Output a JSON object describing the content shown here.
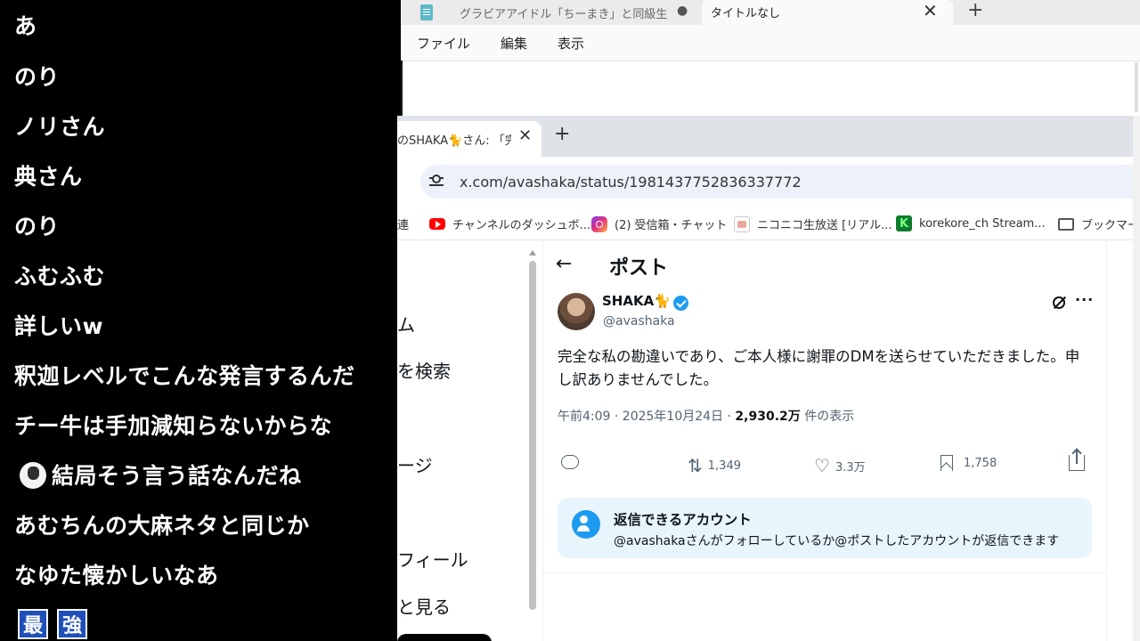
{
  "comments": [
    {
      "text": "あ"
    },
    {
      "text": "のり"
    },
    {
      "text": "ノリさん"
    },
    {
      "text": "典さん"
    },
    {
      "text": "のり"
    },
    {
      "text": "ふむふむ"
    },
    {
      "text": "詳しいw"
    },
    {
      "text": "釈迦レベルでこんな発言するんだ"
    },
    {
      "text": "チー牛は手加減知らないからな"
    },
    {
      "text": "結局そう言う話なんだね"
    },
    {
      "text": "あむちんの大麻ネタと同じか"
    },
    {
      "text": "なゆた懐かしいなあ"
    }
  ],
  "badges": [
    "最",
    "強"
  ],
  "notepad": {
    "tab1_title": "グラビアアイドル「ちーまき」と同級生",
    "tab1_dot": "●",
    "tab2_title": "タイトルなし",
    "close_glyph": "✕",
    "new_tab_glyph": "+",
    "menu": [
      "ファイル",
      "編集",
      "表示"
    ]
  },
  "browser": {
    "tab_title": "のSHAKA🐈さん: 「完",
    "tab_close_glyph": "✕",
    "new_tab_glyph": "+",
    "url": "x.com/avashaka/status/1981437752836337772",
    "bookmarks": [
      {
        "label": "チャンネルのダッシュボ...",
        "icon": "youtube-icon"
      },
      {
        "label": "(2) 受信箱・チャット",
        "icon": "instagram-icon"
      },
      {
        "label": "ニコニコ生放送 [リアル...",
        "icon": "niconico-icon"
      },
      {
        "label": "korekore_ch Stream...",
        "icon": "kick-icon"
      },
      {
        "label": "ブックマーク",
        "icon": "folder-icon"
      }
    ],
    "bookmark_partial": "連"
  },
  "x": {
    "left_nav": [
      "ム",
      "を検索",
      "ージ",
      "フィール",
      "と見る"
    ],
    "back_glyph": "←",
    "header_title": "ポスト",
    "author_name": "SHAKA🐈",
    "author_handle": "@avashaka",
    "more_glyph": "···",
    "post_text": "完全な私の勘違いであり、ご本人様に謝罪のDMを送らせていただきました。申し訳ありませんでした。",
    "meta_time": "午前4:09 · 2025年10月24日 · ",
    "meta_views": "2,930.2万",
    "meta_views_suffix": " 件の表示",
    "retweets": "1,349",
    "likes": "3.3万",
    "bookmarks": "1,758",
    "retweet_glyph": "⇅",
    "like_glyph": "♡",
    "reply_title": "返信できるアカウント",
    "reply_desc": "@avashakaさんがフォローしているか@ポストしたアカウントが返信できます"
  },
  "colors": {
    "accent": "#1d9bf0",
    "text_primary": "#0f1419",
    "text_secondary": "#536471",
    "reply_box_bg": "#e8f5fd",
    "badge_blue": "#1f4fb8"
  }
}
